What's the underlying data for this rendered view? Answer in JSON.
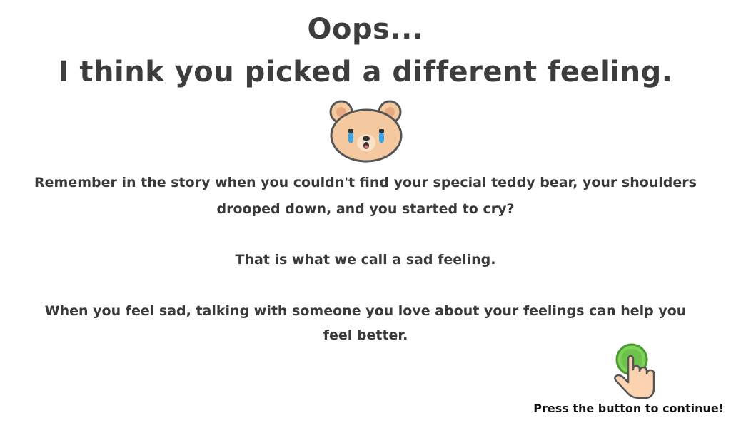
{
  "heading": {
    "line1": "Oops...",
    "line2": "I think you picked a different feeling."
  },
  "illustration": {
    "icon": "crying-bear-icon",
    "colors": {
      "fur": "#f5c9a0",
      "outline": "#555555",
      "tears": "#3aa3e6",
      "blush": "#f2a79a"
    }
  },
  "message": {
    "paragraph1": "Remember in the story when you couldn't find your special teddy bear, your shoulders drooped down, and you started to cry?",
    "paragraph2": "That is what we call a sad feeling.",
    "paragraph3": "When you feel sad, talking with someone you love about your feelings can help you feel better."
  },
  "continue": {
    "icon": "green-button-hand-icon",
    "label": "Press the button to continue!",
    "button_color": "#6cc24a"
  }
}
